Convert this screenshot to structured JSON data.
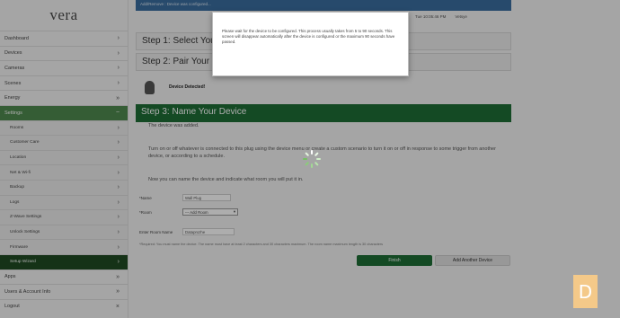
{
  "brand": {
    "logo": "vera"
  },
  "sidebar": {
    "items": [
      {
        "label": "Dashboard",
        "chev": "›"
      },
      {
        "label": "Devices",
        "chev": "›"
      },
      {
        "label": "Cameras",
        "chev": "›"
      },
      {
        "label": "Scenes",
        "chev": "›"
      },
      {
        "label": "Energy",
        "chev": "»"
      },
      {
        "label": "Settings",
        "chev": "−"
      }
    ],
    "sub_items": [
      {
        "label": "Rooms",
        "chev": "›"
      },
      {
        "label": "Customer Care",
        "chev": "›"
      },
      {
        "label": "Location",
        "chev": "›"
      },
      {
        "label": "Net & Wi-fi",
        "chev": "›"
      },
      {
        "label": "Backup",
        "chev": "›"
      },
      {
        "label": "Logs",
        "chev": "›"
      },
      {
        "label": "Z-Wave Settings",
        "chev": "›"
      },
      {
        "label": "Unlock Settings",
        "chev": "›"
      },
      {
        "label": "Firmware",
        "chev": "›"
      },
      {
        "label": "Setup Wizard",
        "chev": "›"
      }
    ],
    "bottom_items": [
      {
        "label": "Apps",
        "chev": "»"
      },
      {
        "label": "Users & Account Info",
        "chev": "»"
      },
      {
        "label": "Logout",
        "chev": "×"
      }
    ]
  },
  "topbar": {
    "text": "Add/Remove : Device was configured..."
  },
  "topinfo": {
    "time": "Tue 10:05:46 PM",
    "link": "Vetsye"
  },
  "steps": {
    "step1": "Step 1: Select Your",
    "step2": "Step 2: Pair Your D",
    "detected": "Device Detected!",
    "step3": "Step 3: Name Your Device"
  },
  "body": {
    "p1": "The device was added.",
    "p2": "Turn on or off whatever is connected to this plug using the device menu or create a custom scenario to turn it on or off in response to some trigger from another device, or according to a schedule.",
    "p3": "Now you can name the device and indicate what room you will put it in."
  },
  "form": {
    "name_label": "*Name",
    "name_value": "Wall Plug",
    "room_label": "*Room",
    "room_value": "--- Add Room",
    "room_arrow": "▾",
    "enter_room_label": "Enter Room Name",
    "enter_room_value": "Dataprozhe",
    "help": "*Required: You must name the device. The name must have at least 2 characters and 30 characters maximum. The room name maximum length is 30 characters"
  },
  "buttons": {
    "finish": "Finish",
    "add_another": "Add Another Device"
  },
  "modal": {
    "message": "Please wait for the device to be configured. This process usually takes from 5 to 90 seconds. This screen will disappear automatically after the device is configured or the maximum 90 seconds have passed."
  },
  "colors": {
    "accent": "#1e6e36",
    "sidebar_active": "#4f8a4f",
    "sidebar_current": "#1f4a23",
    "topbar": "#3a6ea0"
  },
  "icons": {
    "bulb": "lightbulb-icon",
    "spinner": "loading-spinner-icon"
  },
  "watermark": "D"
}
